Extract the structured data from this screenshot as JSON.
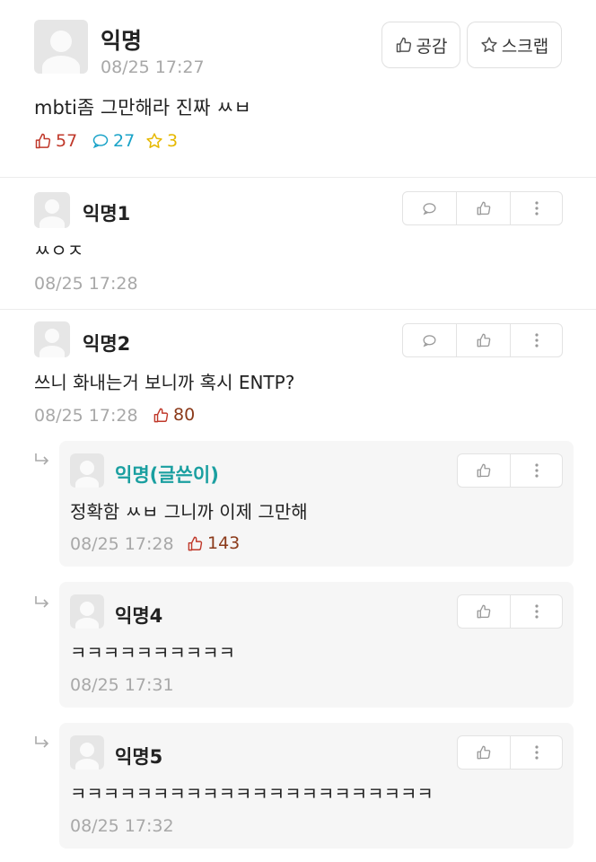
{
  "post": {
    "author": "익명",
    "time": "08/25 17:27",
    "content": "mbti좀 그만해라 진짜 ㅆㅂ",
    "likes": "57",
    "comments": "27",
    "scraps": "3",
    "like_button_label": "공감",
    "scrap_button_label": "스크랩"
  },
  "comments": [
    {
      "author": "익명1",
      "content": "ㅆㅇㅈ",
      "time": "08/25 17:28",
      "likes": ""
    },
    {
      "author": "익명2",
      "content": "쓰니 화내는거 보니까 혹시 ENTP?",
      "time": "08/25 17:28",
      "likes": "80"
    }
  ],
  "replies": [
    {
      "author": "익명(글쓴이)",
      "content": "정확함 ㅆㅂ 그니까 이제 그만해",
      "time": "08/25 17:28",
      "likes": "143"
    },
    {
      "author": "익명4",
      "content": "ㅋㅋㅋㅋㅋㅋㅋㅋㅋㅋ",
      "time": "08/25 17:31",
      "likes": ""
    },
    {
      "author": "익명5",
      "content": "ㅋㅋㅋㅋㅋㅋㅋㅋㅋㅋㅋㅋㅋㅋㅋㅋㅋㅋㅋㅋㅋㅋ",
      "time": "08/25 17:32",
      "likes": ""
    }
  ],
  "colors": {
    "like": "#c0392b",
    "comment": "#1aa3c8",
    "scrap": "#e6b800",
    "op_name": "#1a9fa0",
    "reply_like": "#8b3a1a"
  },
  "icons": [
    "thumb-up-icon",
    "speech-bubble-icon",
    "star-icon",
    "more-vertical-icon",
    "reply-arrow-icon"
  ]
}
